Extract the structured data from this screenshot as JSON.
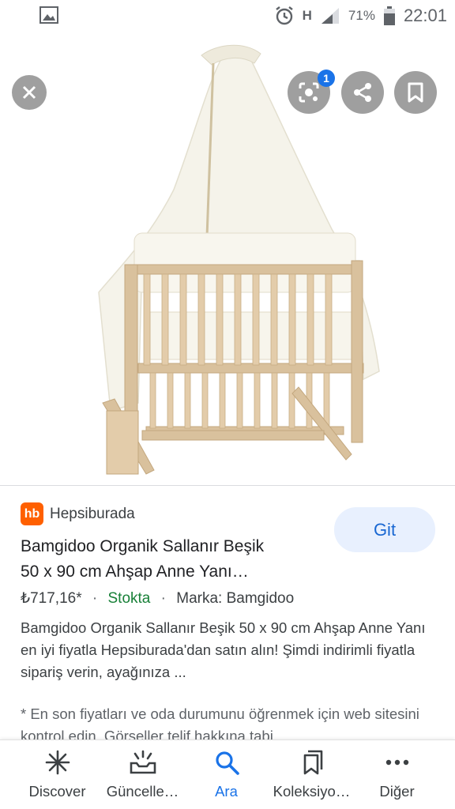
{
  "status_bar": {
    "battery": "71%",
    "time": "22:01",
    "network": "H"
  },
  "image_overlay": {
    "lens_badge_count": "1"
  },
  "result": {
    "source_logo_text": "hb",
    "source_name": "Hepsiburada",
    "visit_button": "Git",
    "title_line1": "Bamgidoo Organik Sallanır Beşik",
    "title_line2": "50 x 90 cm Ahşap Anne Yanı…",
    "price": "₺717,16*",
    "separator": "·",
    "stock": "Stokta",
    "brand": "Marka: Bamgidoo",
    "description": "Bamgidoo Organik Sallanır Beşik 50 x 90 cm Ahşap Anne Yanı en iyi fiyatla Hepsiburada'dan satın alın! Şimdi indirimli fiyatla sipariş verin, ayağınıza ...",
    "disclaimer": "* En son fiyatları ve oda durumunu öğrenmek için web sitesini kontrol edin. Görseller telif hakkına tabi"
  },
  "bottom_nav": {
    "items": [
      {
        "label": "Discover",
        "icon": "asterisk-icon"
      },
      {
        "label": "Güncelle…",
        "icon": "updates-icon"
      },
      {
        "label": "Ara",
        "icon": "search-icon"
      },
      {
        "label": "Koleksiyo…",
        "icon": "collections-icon"
      },
      {
        "label": "Diğer",
        "icon": "more-icon"
      }
    ],
    "active_index": 2
  },
  "colors": {
    "accent": "#1a73e8",
    "stock": "#188038",
    "brand_logo": "#ff6000",
    "visit_button_bg": "#e8f0fe"
  }
}
